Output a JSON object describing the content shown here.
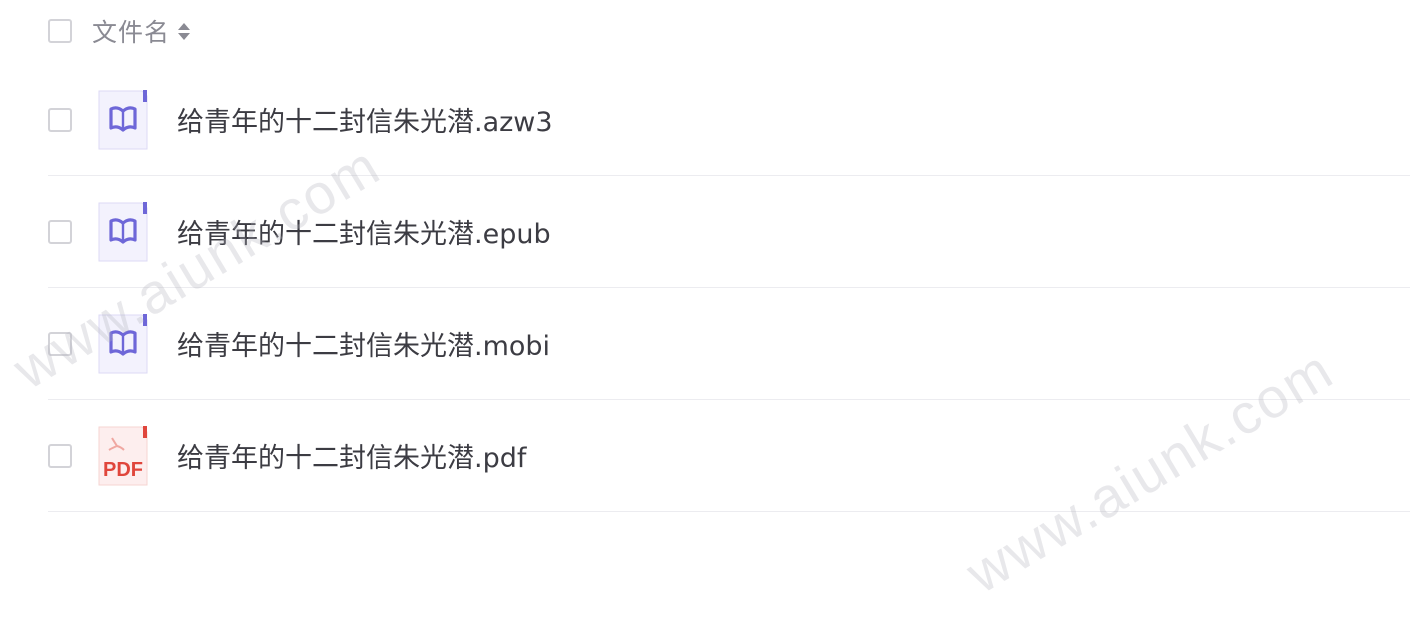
{
  "header": {
    "column_label": "文件名"
  },
  "files": [
    {
      "name": "给青年的十二封信朱光潜.azw3",
      "icon": "ebook-icon"
    },
    {
      "name": "给青年的十二封信朱光潜.epub",
      "icon": "ebook-icon"
    },
    {
      "name": "给青年的十二封信朱光潜.mobi",
      "icon": "ebook-icon"
    },
    {
      "name": "给青年的十二封信朱光潜.pdf",
      "icon": "pdf-icon",
      "icon_text": "PDF"
    }
  ],
  "watermark": {
    "text": "www.aiunk.com"
  },
  "colors": {
    "ebook_accent": "#6e67d8",
    "ebook_bg": "#f3f2fd",
    "pdf_accent": "#e0463c",
    "pdf_bg": "#fdeeee"
  }
}
